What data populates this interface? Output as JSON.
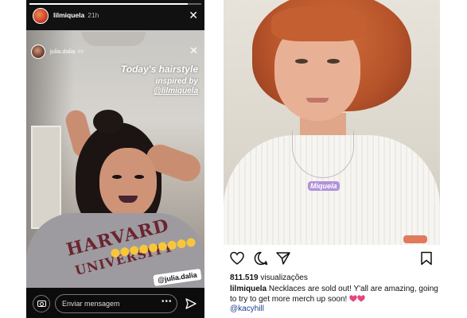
{
  "story": {
    "top_user": "lilmiquela",
    "top_time": "21h",
    "progress": 0.92,
    "inner_user": "julia.dalia",
    "inner_time": "4h",
    "caption": {
      "line1": "Today's hairstyle",
      "line2": "inspired by",
      "line3": "@lilmiquela"
    },
    "shirt_text_1": "HARVARD",
    "shirt_text_2": "UNIVERSITY",
    "mention_sticker": "@julia.dalia",
    "message_placeholder": "Enviar mensagem",
    "more_label": "•••",
    "icons": [
      "close-icon",
      "camera-icon",
      "send-icon",
      "more-icon"
    ]
  },
  "post": {
    "necklace_text": "Miquela",
    "views_count": "811.519",
    "views_label": "visualizações",
    "caption_user": "lilmiquela",
    "caption_text": "Necklaces are sold out! Y'all are amazing, going to try to get more merch up soon!",
    "caption_tag": "@kacyhill",
    "accent_pink": "#e8457d",
    "icons": [
      "heart-icon",
      "comment-icon",
      "share-icon",
      "bookmark-icon"
    ]
  }
}
